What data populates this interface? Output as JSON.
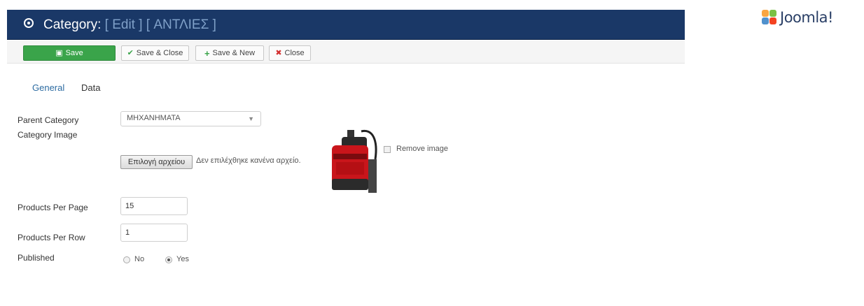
{
  "header": {
    "title_prefix": "Category:",
    "title_detail": "[ Edit ] [ ΑΝΤΛΙΕΣ ]",
    "icon": "target-icon",
    "color": "#1a3867"
  },
  "brand": {
    "logo_text": "Joomla!",
    "logo_icon": "joomla-logo-icon"
  },
  "toolbar": {
    "save": {
      "label": "Save",
      "icon": "save-icon"
    },
    "save_close": {
      "label": "Save & Close",
      "icon": "check-icon"
    },
    "save_new": {
      "label": "Save & New",
      "icon": "plus-icon"
    },
    "close": {
      "label": "Close",
      "icon": "close-icon"
    },
    "save_color": "#3aa44a"
  },
  "tabs": [
    {
      "label": "General",
      "active": true
    },
    {
      "label": "Data",
      "active": false
    }
  ],
  "form": {
    "parent_category": {
      "label": "Parent Category",
      "value": "ΜΗΧΑΝΗΜΑΤΑ"
    },
    "category_image": {
      "label": "Category Image",
      "file_button": "Επιλογή αρχείου",
      "file_status": "Δεν επιλέχθηκε κανένα αρχείο.",
      "remove_label": "Remove image",
      "remove_checked": false
    },
    "products_per_page": {
      "label": "Products Per Page",
      "value": "15"
    },
    "products_per_row": {
      "label": "Products Per Row",
      "value": "1"
    },
    "published": {
      "label": "Published",
      "options": [
        "No",
        "Yes"
      ],
      "selected": "Yes"
    }
  }
}
